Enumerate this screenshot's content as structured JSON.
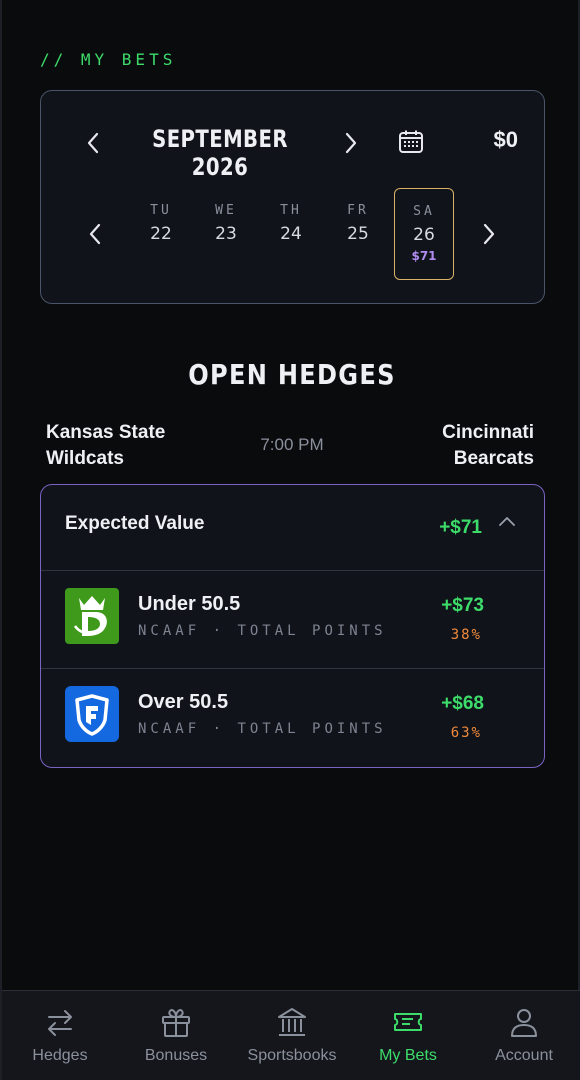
{
  "header": {
    "section_label": "// MY BETS"
  },
  "calendar": {
    "month_label": "SEPTEMBER 2026",
    "balance": "$0",
    "days": [
      {
        "dow": "TU",
        "num": "22",
        "amount": ""
      },
      {
        "dow": "WE",
        "num": "23",
        "amount": ""
      },
      {
        "dow": "TH",
        "num": "24",
        "amount": ""
      },
      {
        "dow": "FR",
        "num": "25",
        "amount": ""
      },
      {
        "dow": "SA",
        "num": "26",
        "amount": "$71"
      }
    ],
    "selected_index": 4
  },
  "open_hedges": {
    "title": "OPEN HEDGES",
    "game": {
      "team_left_line1": "Kansas State",
      "team_left_line2": "Wildcats",
      "time": "7:00 PM",
      "team_right_line1": "Cincinnati",
      "team_right_line2": "Bearcats"
    },
    "expected_value": {
      "label": "Expected Value",
      "value": "+$71"
    },
    "bets": [
      {
        "book": "draftkings-logo",
        "title": "Under 50.5",
        "league": "NCAAF",
        "market": "TOTAL POINTS",
        "amount": "+$73",
        "pct": "38%"
      },
      {
        "book": "fanduel-logo",
        "title": "Over 50.5",
        "league": "NCAAF",
        "market": "TOTAL POINTS",
        "amount": "+$68",
        "pct": "63%"
      }
    ]
  },
  "nav": {
    "items": [
      {
        "label": "Hedges",
        "icon": "swap-arrows-icon"
      },
      {
        "label": "Bonuses",
        "icon": "gift-icon"
      },
      {
        "label": "Sportsbooks",
        "icon": "bank-icon"
      },
      {
        "label": "My Bets",
        "icon": "ticket-icon"
      },
      {
        "label": "Account",
        "icon": "user-icon"
      }
    ],
    "active_index": 3
  },
  "colors": {
    "accent_green": "#3ddc6a",
    "accent_purple": "#b18cf0",
    "accent_orange": "#f08a3c",
    "selected_border": "#d9b266",
    "background": "#0a0b0d"
  }
}
